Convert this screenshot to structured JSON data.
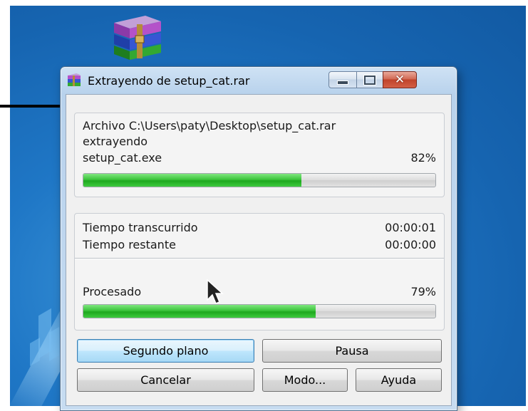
{
  "window": {
    "title": "Extrayendo de setup_cat.rar",
    "buttons": {
      "minimize": "minimize",
      "maximize": "maximize",
      "close": "close"
    }
  },
  "file_section": {
    "archive_line": "Archivo C:\\Users\\paty\\Desktop\\setup_cat.rar",
    "action": "extrayendo",
    "current_file": "setup_cat.exe",
    "file_percent": "82%",
    "file_progress": 0.62
  },
  "time_section": {
    "elapsed_label": "Tiempo transcurrido",
    "elapsed_value": "00:00:01",
    "remaining_label": "Tiempo restante",
    "remaining_value": "00:00:00",
    "processed_label": "Procesado",
    "processed_percent": "79%",
    "processed_progress": 0.66
  },
  "buttons": {
    "background": "Segundo plano",
    "pause": "Pausa",
    "cancel": "Cancelar",
    "mode": "Modo...",
    "help": "Ayuda"
  },
  "colors": {
    "accent_green": "#2db82d",
    "desktop_blue": "#1664b0",
    "close_red": "#c0432b"
  },
  "icons": [
    "winrar-icon",
    "arrow-annotation-icon",
    "mouse-cursor-icon"
  ]
}
